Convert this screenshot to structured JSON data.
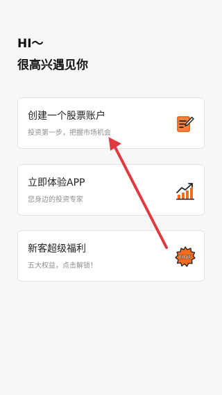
{
  "greeting": {
    "hi": "HI～",
    "subtitle": "很高兴遇见你"
  },
  "cards": [
    {
      "title": "创建一个股票账户",
      "desc": "投资第一步，把握市场机会",
      "icon": "edit-document-icon"
    },
    {
      "title": "立即体验APP",
      "desc": "您身边的投资专家",
      "icon": "trend-chart-icon"
    },
    {
      "title": "新客超级福利",
      "desc": "五大权益，点击解锁！",
      "icon": "hot-badge-icon",
      "badge_text": "HOT"
    }
  ],
  "colors": {
    "accent_orange": "#f26b1f",
    "annotation_red": "#e0393e",
    "card_border": "#e2e2e2",
    "background": "#f7f7f7"
  }
}
